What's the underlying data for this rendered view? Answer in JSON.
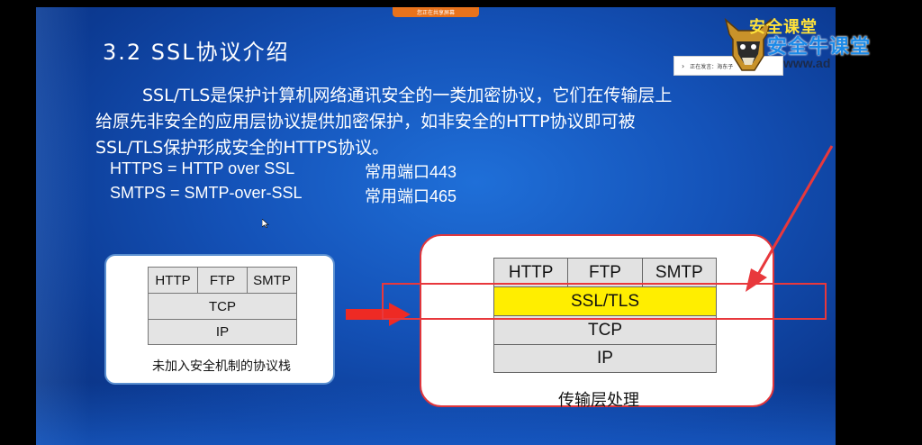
{
  "share_banner": {
    "text": "您正在共享屏幕"
  },
  "speaking_popup": {
    "text": "正在发言：海东子"
  },
  "slide": {
    "title": "3.2 SSL协议介绍",
    "paragraph_lines": [
      "SSL/TLS是保护计算机网络通讯安全的一类加密协议，它们在传输层上",
      "给原先非安全的应用层协议提供加密保护，如非安全的HTTP协议即可被",
      "SSL/TLS保护形成安全的HTTPS协议。"
    ],
    "protocols": [
      {
        "name": "HTTPS  =  HTTP over SSL",
        "port": "常用端口443"
      },
      {
        "name": "SMTPS =  SMTP-over-SSL",
        "port": "常用端口465"
      }
    ],
    "left_diagram": {
      "app_layer": [
        "HTTP",
        "FTP",
        "SMTP"
      ],
      "transport": "TCP",
      "network": "IP",
      "caption": "未加入安全机制的协议栈"
    },
    "right_diagram": {
      "app_layer": [
        "HTTP",
        "FTP",
        "SMTP"
      ],
      "security": "SSL/TLS",
      "transport": "TCP",
      "network": "IP",
      "caption": "传输层处理"
    }
  },
  "watermark": {
    "top_text": "安全课堂",
    "main_text": "安全牛课堂",
    "url_text": "www.ad"
  },
  "colors": {
    "slide_bg": "#1452b8",
    "highlight": "#e8383c",
    "ssl_fill": "#ffee00",
    "banner": "#e8731c"
  }
}
